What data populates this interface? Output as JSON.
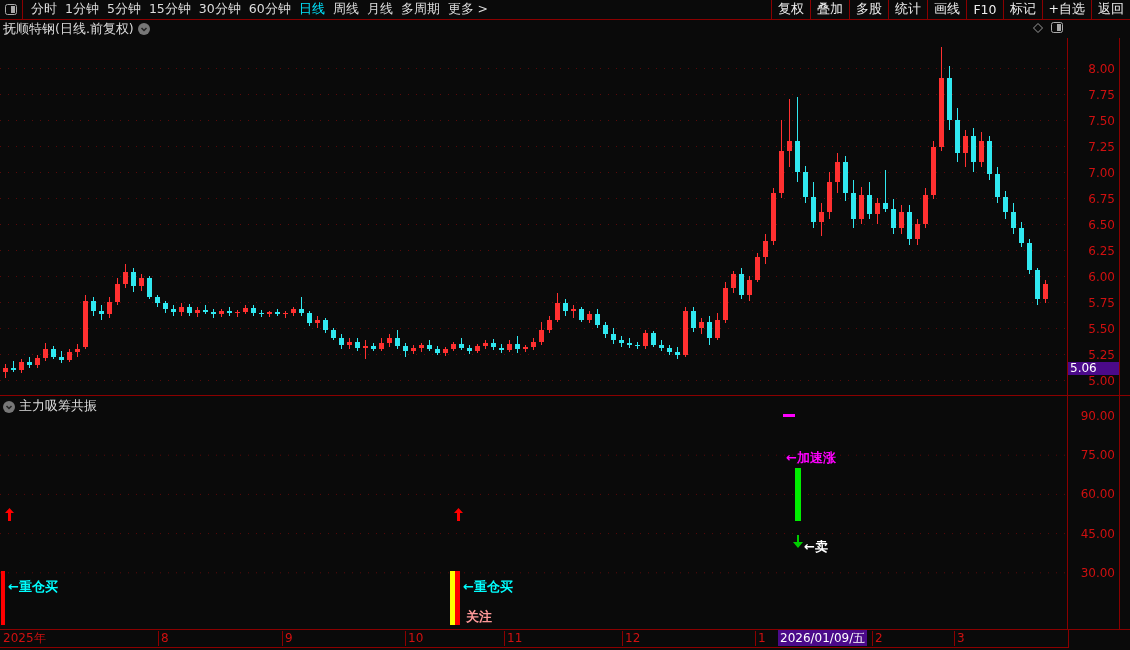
{
  "toolbar": {
    "periods": [
      {
        "label": "分时",
        "selected": false
      },
      {
        "label": "1分钟",
        "selected": false
      },
      {
        "label": "5分钟",
        "selected": false
      },
      {
        "label": "15分钟",
        "selected": false
      },
      {
        "label": "30分钟",
        "selected": false
      },
      {
        "label": "60分钟",
        "selected": false
      },
      {
        "label": "日线",
        "selected": true
      },
      {
        "label": "周线",
        "selected": false
      },
      {
        "label": "月线",
        "selected": false
      },
      {
        "label": "多周期",
        "selected": false
      },
      {
        "label": "更多 >",
        "selected": false
      }
    ],
    "buttons": [
      "复权",
      "叠加",
      "多股",
      "统计",
      "画线",
      "F10",
      "标记",
      "+自选",
      "返回"
    ]
  },
  "price_chart": {
    "title": "抚顺特钢(日线.前复权)",
    "current_price": "5.06",
    "chart_data": {
      "type": "candlestick",
      "ylim": [
        5.0,
        8.0
      ],
      "grid": true,
      "yticks": [
        {
          "value": 8.0,
          "label": "8.00"
        },
        {
          "value": 7.75,
          "label": "7.75"
        },
        {
          "value": 7.5,
          "label": "7.50"
        },
        {
          "value": 7.25,
          "label": "7.25"
        },
        {
          "value": 7.0,
          "label": "7.00"
        },
        {
          "value": 6.75,
          "label": "6.75"
        },
        {
          "value": 6.5,
          "label": "6.50"
        },
        {
          "value": 6.25,
          "label": "6.25"
        },
        {
          "value": 6.0,
          "label": "6.00"
        },
        {
          "value": 5.75,
          "label": "5.75"
        },
        {
          "value": 5.5,
          "label": "5.50"
        },
        {
          "value": 5.25,
          "label": "5.25"
        },
        {
          "value": 5.0,
          "label": "5.00"
        }
      ],
      "categories": [
        null,
        null,
        null,
        null,
        null,
        null,
        null,
        null,
        null,
        null,
        null,
        null,
        null,
        null,
        null,
        null,
        null,
        null,
        null,
        null,
        null,
        null,
        null,
        null,
        null,
        null,
        null,
        null,
        null,
        null,
        null,
        null,
        null,
        null,
        null,
        null,
        null,
        null,
        null,
        null,
        null,
        null,
        null,
        null,
        null,
        null,
        null,
        null,
        null,
        null,
        null,
        null,
        null,
        null,
        null,
        null,
        null,
        null,
        null,
        null,
        null,
        null,
        null,
        null,
        null,
        null,
        null,
        null,
        null,
        null,
        null,
        null,
        null,
        null,
        null,
        null,
        null,
        null,
        null,
        null,
        null,
        null,
        null,
        null,
        null,
        null,
        null,
        null,
        null,
        null,
        null,
        null,
        null,
        null,
        null,
        null,
        null,
        null,
        null,
        null,
        null,
        null,
        null,
        null,
        null,
        null,
        null,
        null,
        null,
        null,
        null,
        null,
        null,
        null,
        null,
        null,
        null,
        null,
        null,
        null,
        null,
        null,
        null,
        null,
        null,
        null,
        null,
        null,
        null,
        null,
        null
      ],
      "ohlc": [
        [
          5.08,
          5.15,
          5.02,
          5.12
        ],
        [
          5.12,
          5.18,
          5.08,
          5.1
        ],
        [
          5.1,
          5.2,
          5.07,
          5.17
        ],
        [
          5.17,
          5.22,
          5.12,
          5.14
        ],
        [
          5.14,
          5.24,
          5.12,
          5.21
        ],
        [
          5.21,
          5.36,
          5.18,
          5.3
        ],
        [
          5.3,
          5.33,
          5.2,
          5.22
        ],
        [
          5.22,
          5.28,
          5.16,
          5.19
        ],
        [
          5.19,
          5.3,
          5.17,
          5.27
        ],
        [
          5.27,
          5.35,
          5.22,
          5.3
        ],
        [
          5.32,
          5.82,
          5.3,
          5.76
        ],
        [
          5.76,
          5.8,
          5.62,
          5.66
        ],
        [
          5.66,
          5.72,
          5.58,
          5.63
        ],
        [
          5.63,
          5.8,
          5.6,
          5.75
        ],
        [
          5.75,
          5.98,
          5.72,
          5.92
        ],
        [
          5.92,
          6.12,
          5.88,
          6.04
        ],
        [
          6.04,
          6.08,
          5.85,
          5.9
        ],
        [
          5.9,
          6.02,
          5.86,
          5.98
        ],
        [
          5.98,
          6.0,
          5.78,
          5.8
        ],
        [
          5.8,
          5.82,
          5.7,
          5.74
        ],
        [
          5.74,
          5.76,
          5.64,
          5.68
        ],
        [
          5.68,
          5.72,
          5.62,
          5.65
        ],
        [
          5.65,
          5.74,
          5.62,
          5.7
        ],
        [
          5.7,
          5.73,
          5.62,
          5.64
        ],
        [
          5.64,
          5.7,
          5.61,
          5.67
        ],
        [
          5.67,
          5.72,
          5.63,
          5.65
        ],
        [
          5.65,
          5.68,
          5.6,
          5.63
        ],
        [
          5.63,
          5.68,
          5.61,
          5.66
        ],
        [
          5.66,
          5.7,
          5.62,
          5.64
        ],
        [
          5.64,
          5.67,
          5.61,
          5.65
        ],
        [
          5.65,
          5.72,
          5.63,
          5.69
        ],
        [
          5.69,
          5.72,
          5.62,
          5.64
        ],
        [
          5.64,
          5.67,
          5.61,
          5.63
        ],
        [
          5.63,
          5.66,
          5.61,
          5.65
        ],
        [
          5.65,
          5.68,
          5.62,
          5.63
        ],
        [
          5.63,
          5.66,
          5.6,
          5.64
        ],
        [
          5.64,
          5.7,
          5.62,
          5.68
        ],
        [
          5.68,
          5.8,
          5.62,
          5.64
        ],
        [
          5.64,
          5.66,
          5.52,
          5.55
        ],
        [
          5.55,
          5.62,
          5.5,
          5.58
        ],
        [
          5.58,
          5.6,
          5.45,
          5.48
        ],
        [
          5.48,
          5.5,
          5.38,
          5.4
        ],
        [
          5.4,
          5.44,
          5.3,
          5.34
        ],
        [
          5.34,
          5.4,
          5.3,
          5.37
        ],
        [
          5.37,
          5.4,
          5.28,
          5.31
        ],
        [
          5.31,
          5.38,
          5.2,
          5.33
        ],
        [
          5.33,
          5.36,
          5.28,
          5.3
        ],
        [
          5.3,
          5.4,
          5.28,
          5.36
        ],
        [
          5.36,
          5.44,
          5.32,
          5.4
        ],
        [
          5.4,
          5.48,
          5.3,
          5.33
        ],
        [
          5.33,
          5.36,
          5.22,
          5.28
        ],
        [
          5.28,
          5.34,
          5.25,
          5.31
        ],
        [
          5.31,
          5.36,
          5.27,
          5.34
        ],
        [
          5.34,
          5.38,
          5.28,
          5.3
        ],
        [
          5.3,
          5.33,
          5.24,
          5.26
        ],
        [
          5.26,
          5.32,
          5.23,
          5.3
        ],
        [
          5.3,
          5.37,
          5.28,
          5.35
        ],
        [
          5.35,
          5.4,
          5.29,
          5.31
        ],
        [
          5.31,
          5.34,
          5.25,
          5.28
        ],
        [
          5.28,
          5.35,
          5.26,
          5.33
        ],
        [
          5.33,
          5.38,
          5.3,
          5.36
        ],
        [
          5.36,
          5.39,
          5.29,
          5.32
        ],
        [
          5.31,
          5.35,
          5.26,
          5.29
        ],
        [
          5.29,
          5.38,
          5.27,
          5.35
        ],
        [
          5.35,
          5.42,
          5.26,
          5.3
        ],
        [
          5.3,
          5.34,
          5.27,
          5.32
        ],
        [
          5.32,
          5.4,
          5.29,
          5.37
        ],
        [
          5.37,
          5.56,
          5.34,
          5.48
        ],
        [
          5.48,
          5.62,
          5.45,
          5.58
        ],
        [
          5.58,
          5.84,
          5.56,
          5.74
        ],
        [
          5.74,
          5.78,
          5.62,
          5.66
        ],
        [
          5.66,
          5.72,
          5.6,
          5.68
        ],
        [
          5.68,
          5.7,
          5.56,
          5.58
        ],
        [
          5.58,
          5.66,
          5.55,
          5.63
        ],
        [
          5.63,
          5.68,
          5.5,
          5.53
        ],
        [
          5.53,
          5.56,
          5.4,
          5.44
        ],
        [
          5.44,
          5.5,
          5.35,
          5.38
        ],
        [
          5.38,
          5.42,
          5.32,
          5.36
        ],
        [
          5.36,
          5.4,
          5.31,
          5.34
        ],
        [
          5.34,
          5.37,
          5.3,
          5.33
        ],
        [
          5.33,
          5.48,
          5.3,
          5.45
        ],
        [
          5.45,
          5.47,
          5.32,
          5.34
        ],
        [
          5.34,
          5.38,
          5.28,
          5.31
        ],
        [
          5.31,
          5.34,
          5.24,
          5.27
        ],
        [
          5.27,
          5.32,
          5.2,
          5.24
        ],
        [
          5.24,
          5.7,
          5.22,
          5.66
        ],
        [
          5.66,
          5.7,
          5.46,
          5.5
        ],
        [
          5.5,
          5.6,
          5.44,
          5.56
        ],
        [
          5.56,
          5.62,
          5.34,
          5.4
        ],
        [
          5.4,
          5.64,
          5.38,
          5.58
        ],
        [
          5.58,
          5.94,
          5.55,
          5.88
        ],
        [
          5.88,
          6.05,
          5.84,
          6.02
        ],
        [
          6.02,
          6.08,
          5.78,
          5.82
        ],
        [
          5.82,
          6.0,
          5.76,
          5.96
        ],
        [
          5.96,
          6.22,
          5.94,
          6.18
        ],
        [
          6.18,
          6.4,
          6.12,
          6.34
        ],
        [
          6.34,
          6.85,
          6.3,
          6.8
        ],
        [
          6.8,
          7.5,
          6.75,
          7.2
        ],
        [
          7.2,
          7.7,
          7.05,
          7.3
        ],
        [
          7.3,
          7.72,
          6.9,
          7.0
        ],
        [
          7.0,
          7.06,
          6.7,
          6.76
        ],
        [
          6.76,
          6.9,
          6.46,
          6.52
        ],
        [
          6.52,
          6.7,
          6.38,
          6.62
        ],
        [
          6.62,
          7.0,
          6.55,
          6.9
        ],
        [
          6.9,
          7.18,
          6.8,
          7.1
        ],
        [
          7.1,
          7.15,
          6.72,
          6.8
        ],
        [
          6.8,
          6.92,
          6.46,
          6.55
        ],
        [
          6.55,
          6.86,
          6.5,
          6.78
        ],
        [
          6.78,
          6.9,
          6.55,
          6.6
        ],
        [
          6.6,
          6.75,
          6.5,
          6.7
        ],
        [
          6.7,
          7.02,
          6.62,
          6.64
        ],
        [
          6.64,
          6.74,
          6.4,
          6.46
        ],
        [
          6.46,
          6.68,
          6.4,
          6.62
        ],
        [
          6.62,
          6.68,
          6.3,
          6.36
        ],
        [
          6.36,
          6.55,
          6.3,
          6.5
        ],
        [
          6.5,
          6.85,
          6.46,
          6.78
        ],
        [
          6.78,
          7.3,
          6.74,
          7.24
        ],
        [
          7.24,
          8.2,
          7.2,
          7.9
        ],
        [
          7.9,
          8.02,
          7.4,
          7.5
        ],
        [
          7.5,
          7.62,
          7.1,
          7.18
        ],
        [
          7.18,
          7.4,
          7.05,
          7.35
        ],
        [
          7.35,
          7.42,
          7.0,
          7.1
        ],
        [
          7.1,
          7.38,
          7.05,
          7.3
        ],
        [
          7.3,
          7.35,
          6.92,
          6.98
        ],
        [
          6.98,
          7.05,
          6.7,
          6.76
        ],
        [
          6.76,
          6.82,
          6.55,
          6.62
        ],
        [
          6.62,
          6.7,
          6.4,
          6.46
        ],
        [
          6.46,
          6.52,
          6.28,
          6.32
        ],
        [
          6.32,
          6.36,
          6.02,
          6.06
        ],
        [
          6.06,
          6.08,
          5.72,
          5.78
        ],
        [
          5.78,
          5.96,
          5.74,
          5.92
        ]
      ]
    }
  },
  "indicator": {
    "title": "主力吸筹共振",
    "ticks": [
      "90.00",
      "75.00",
      "60.00",
      "45.00",
      "30.00"
    ],
    "signals": [
      {
        "text": "←重仓买",
        "color": "#00ffff"
      },
      {
        "text": "←重仓买",
        "color": "#00ffff"
      },
      {
        "text": "关注",
        "color": "#ff9999"
      },
      {
        "text": "←加速涨",
        "color": "#ff00ff"
      },
      {
        "text": "←卖",
        "color": "#ffffff"
      }
    ]
  },
  "date_axis": {
    "labels": [
      "2025年",
      "8",
      "9",
      "10",
      "11",
      "12",
      "1",
      "2",
      "3"
    ],
    "cursor_date": "2026/01/09/五"
  }
}
